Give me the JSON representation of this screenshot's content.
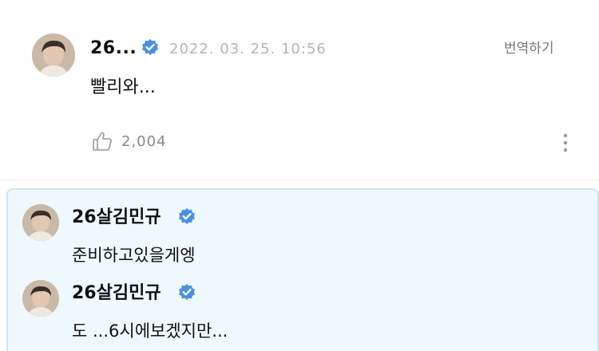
{
  "post": {
    "author": "26...",
    "date": "2022. 03. 25. 10:56",
    "translate_label": "번역하기",
    "text": "빨리와...",
    "like_count": "2,004"
  },
  "replies": [
    {
      "author": "26살김민규",
      "text": "준비하고있을게엥"
    },
    {
      "author": "26살김민규",
      "text": "도 ...6시에보겠지만..."
    }
  ],
  "colors": {
    "verified_badge": "#4a90e2",
    "reply_background": "#eef8fd",
    "reply_border": "#cde6f3",
    "muted_text": "#b5b5b5"
  }
}
